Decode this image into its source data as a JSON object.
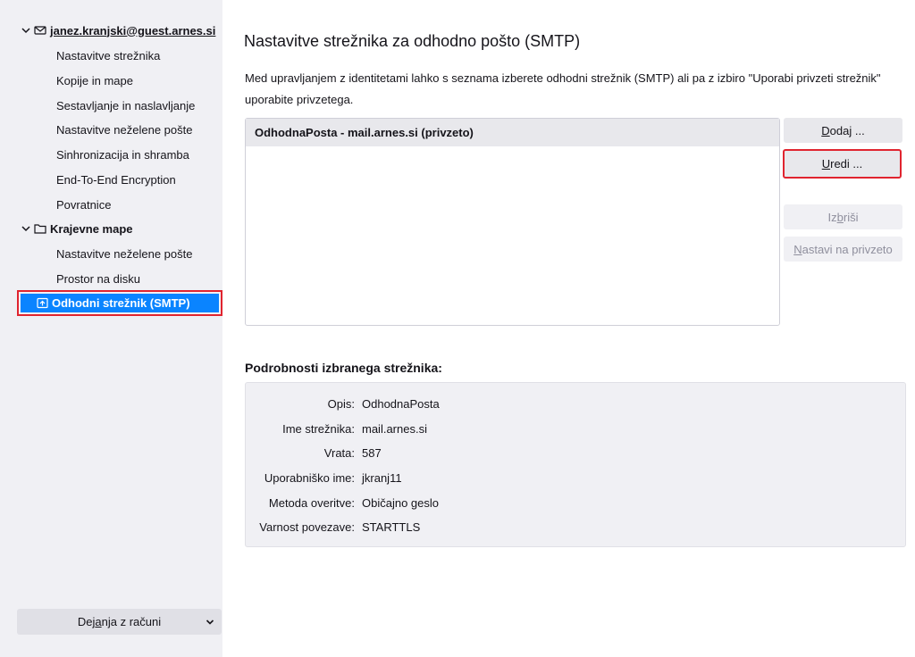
{
  "sidebar": {
    "account": {
      "name": "janez.kranjski@guest.arnes.si",
      "items": [
        "Nastavitve strežnika",
        "Kopije in mape",
        "Sestavljanje in naslavljanje",
        "Nastavitve neželene pošte",
        "Sinhronizacija in shramba",
        "End-To-End Encryption",
        "Povratnice"
      ]
    },
    "local": {
      "name": "Krajevne mape",
      "items": [
        "Nastavitve neželene pošte",
        "Prostor na disku"
      ]
    },
    "smtp_label": "Odhodni strežnik (SMTP)",
    "account_actions": {
      "prefix": "Dej",
      "accesskey": "a",
      "suffix": "nja z računi"
    }
  },
  "main": {
    "title": "Nastavitve strežnika za odhodno pošto (SMTP)",
    "description": "Med upravljanjem z identitetami lahko s seznama izberete odhodni strežnik (SMTP) ali pa z izbiro \"Uporabi privzeti strežnik\" uporabite privzetega.",
    "servers": [
      "OdhodnaPosta - mail.arnes.si (privzeto)"
    ],
    "buttons": {
      "add": {
        "key": "D",
        "rest": "odaj ..."
      },
      "edit": {
        "key": "U",
        "rest": "redi ..."
      },
      "delete": {
        "pre": "Iz",
        "key": "b",
        "rest": "riši"
      },
      "set_default": {
        "key": "N",
        "rest": "astavi na privzeto"
      }
    },
    "details_title": "Podrobnosti izbranega strežnika:",
    "details": [
      {
        "label": "Opis:",
        "value": "OdhodnaPosta"
      },
      {
        "label": "Ime strežnika:",
        "value": "mail.arnes.si"
      },
      {
        "label": "Vrata:",
        "value": "587"
      },
      {
        "label": "Uporabniško ime:",
        "value": "jkranj11"
      },
      {
        "label": "Metoda overitve:",
        "value": "Običajno geslo"
      },
      {
        "label": "Varnost povezave:",
        "value": "STARTTLS"
      }
    ]
  },
  "colors": {
    "accent": "#0a84ff",
    "highlight_border": "#e0242f",
    "sidebar_bg": "#f0f0f4"
  }
}
